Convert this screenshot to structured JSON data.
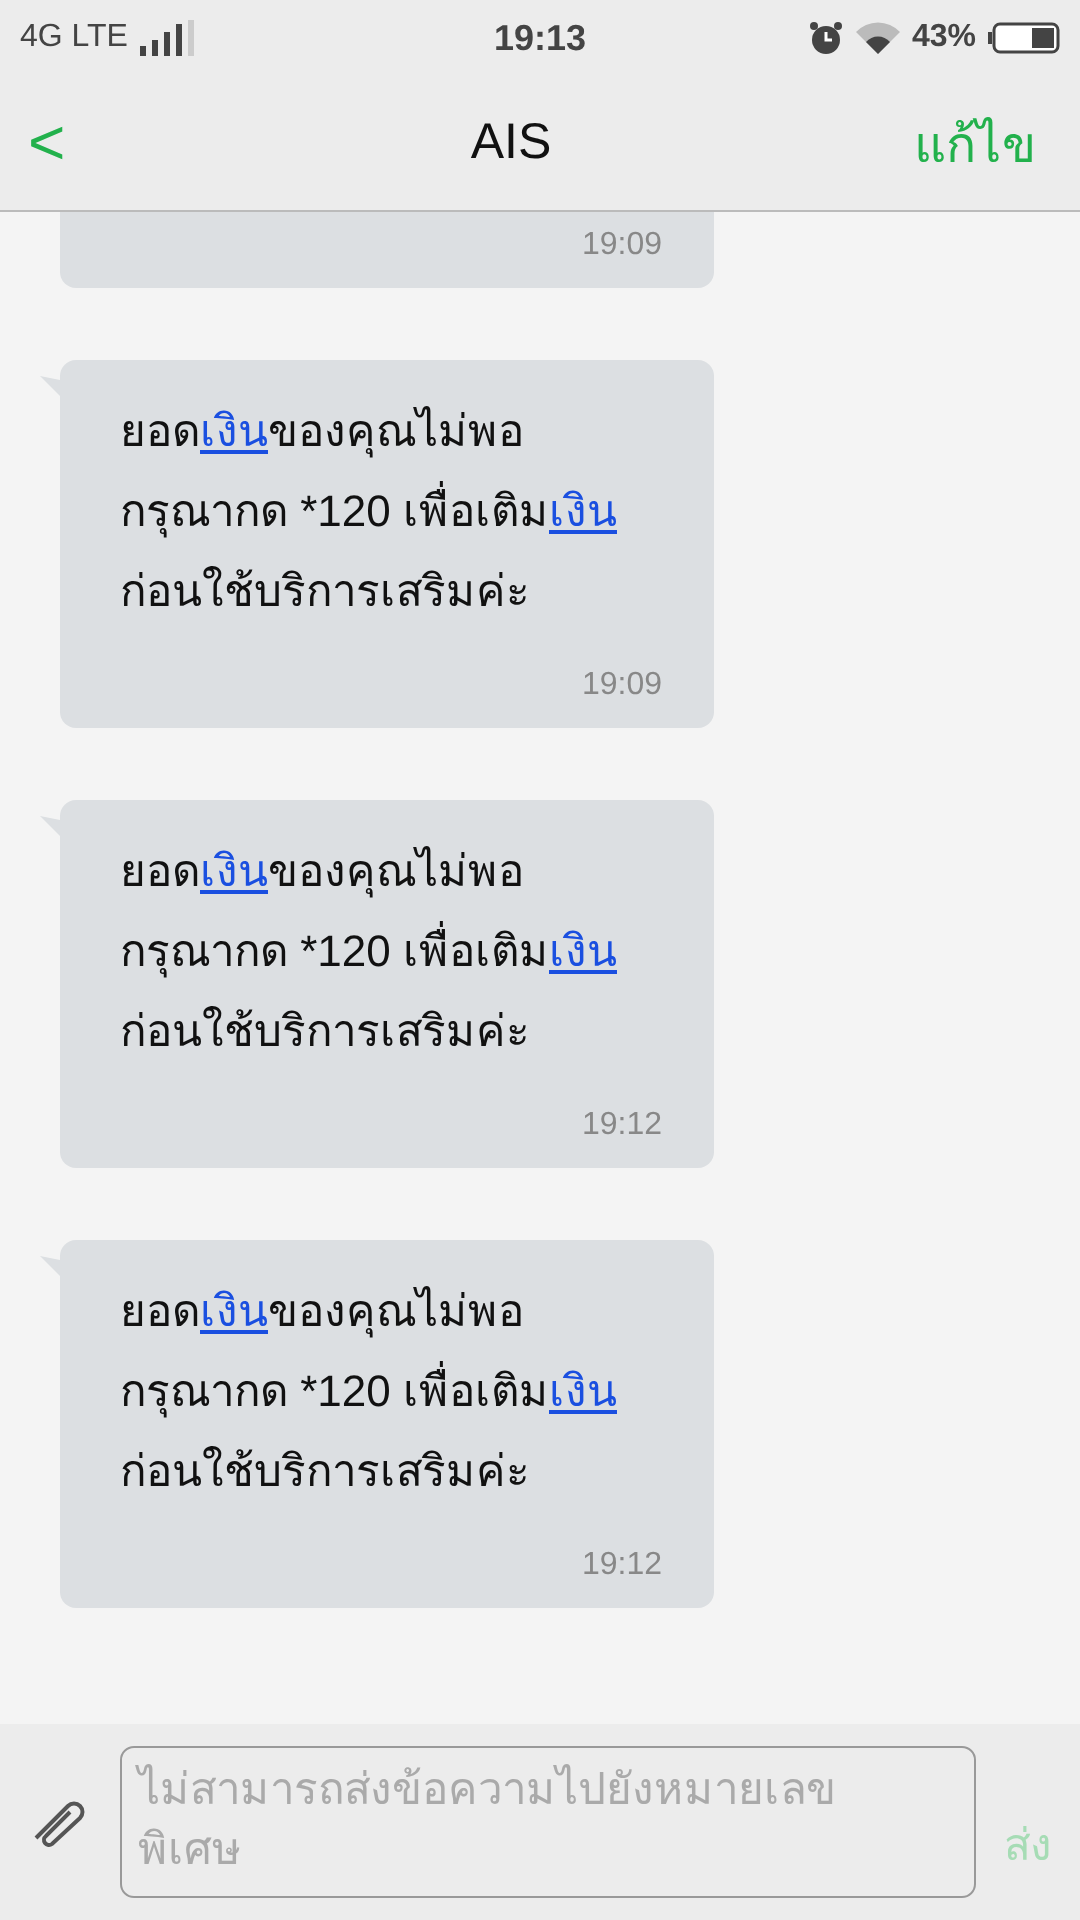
{
  "status_bar": {
    "network": "4G LTE",
    "time": "19:13",
    "battery": "43%"
  },
  "header": {
    "back": "<",
    "title": "AIS",
    "action": "แก้ไข"
  },
  "messages": [
    {
      "partial": true,
      "time": "19:09"
    },
    {
      "partial": false,
      "time": "19:09",
      "lines": [
        [
          {
            "text": "ยอด",
            "link": false
          },
          {
            "text": "เงิน",
            "link": true
          },
          {
            "text": "ของคุณไม่พอ",
            "link": false
          }
        ],
        [
          {
            "text": "กรุณากด *120 เพื่อเติม",
            "link": false
          },
          {
            "text": "เงิน",
            "link": true
          }
        ],
        [
          {
            "text": "ก่อนใช้บริการเสริมค่ะ",
            "link": false
          }
        ]
      ]
    },
    {
      "partial": false,
      "time": "19:12",
      "lines": [
        [
          {
            "text": "ยอด",
            "link": false
          },
          {
            "text": "เงิน",
            "link": true
          },
          {
            "text": "ของคุณไม่พอ",
            "link": false
          }
        ],
        [
          {
            "text": "กรุณากด *120 เพื่อเติม",
            "link": false
          },
          {
            "text": "เงิน",
            "link": true
          }
        ],
        [
          {
            "text": "ก่อนใช้บริการเสริมค่ะ",
            "link": false
          }
        ]
      ]
    },
    {
      "partial": false,
      "time": "19:12",
      "lines": [
        [
          {
            "text": "ยอด",
            "link": false
          },
          {
            "text": "เงิน",
            "link": true
          },
          {
            "text": "ของคุณไม่พอ",
            "link": false
          }
        ],
        [
          {
            "text": "กรุณากด *120 เพื่อเติม",
            "link": false
          },
          {
            "text": "เงิน",
            "link": true
          }
        ],
        [
          {
            "text": "ก่อนใช้บริการเสริมค่ะ",
            "link": false
          }
        ]
      ]
    }
  ],
  "composer": {
    "placeholder": "ไม่สามารถส่งข้อความไปยังหมายเลขพิเศษ",
    "send": "ส่ง",
    "send_disabled": true
  }
}
